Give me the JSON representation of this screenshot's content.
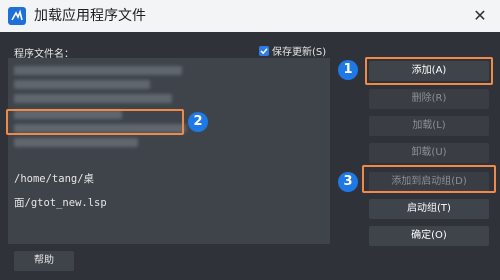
{
  "window": {
    "title": "加载应用程序文件"
  },
  "list": {
    "label": "程序文件名：",
    "selected_path": "/home/tang/桌面/gtot_new.lsp"
  },
  "save_changes": {
    "label": "保存更新(S)",
    "checked": true
  },
  "buttons": {
    "add": "添加(A)",
    "delete": "删除(R)",
    "load": "加载(L)",
    "unload": "卸载(U)",
    "add_to_startup": "添加到启动组(D)",
    "startup_group": "启动组(T)",
    "ok": "确定(O)",
    "help": "帮助"
  },
  "callouts": {
    "one": "1",
    "two": "2",
    "three": "3"
  },
  "colors": {
    "accent": "#1e79e6",
    "highlight": "#f08a4b"
  }
}
